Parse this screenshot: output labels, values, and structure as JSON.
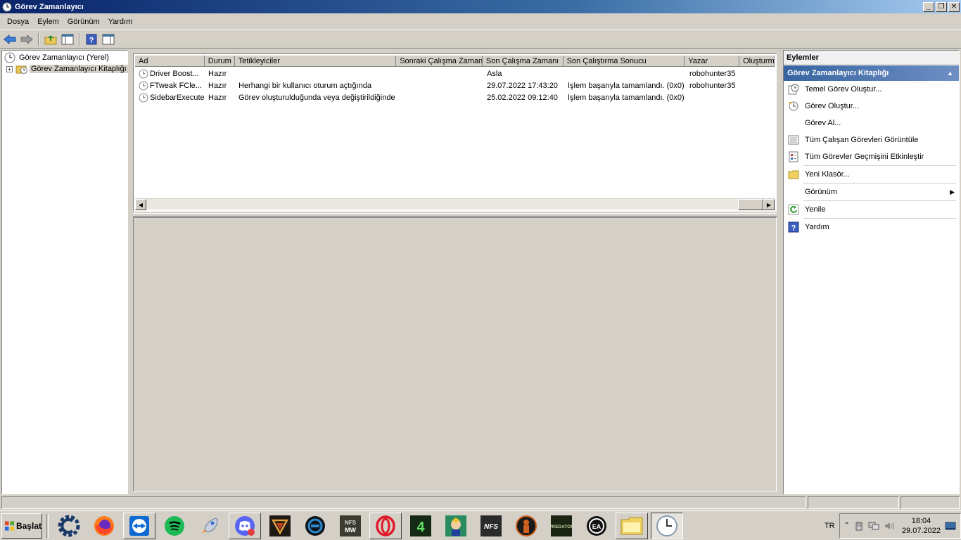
{
  "window": {
    "title": "Görev Zamanlayıcı"
  },
  "menu": [
    "Dosya",
    "Eylem",
    "Görünüm",
    "Yardım"
  ],
  "tree": {
    "root": "Görev Zamanlayıcı (Yerel)",
    "child": "Görev Zamanlayıcı Kitaplığı"
  },
  "tasks": {
    "columns": [
      "Ad",
      "Durum",
      "Tetikleyiciler",
      "Sonraki Çalışma Zamanı",
      "Son Çalışma Zamanı",
      "Son Çalıştırma Sonucu",
      "Yazar",
      "Oluşturm"
    ],
    "rows": [
      {
        "name": "Driver Boost...",
        "status": "Hazır",
        "triggers": "",
        "next_run": "",
        "last_run": "Asla",
        "last_result": "",
        "author": "robohunter35"
      },
      {
        "name": "FTweak FCle...",
        "status": "Hazır",
        "triggers": "Herhangi bir kullanıcı oturum açtığında",
        "next_run": "",
        "last_run": "29.07.2022 17:43:20",
        "last_result": "İşlem başarıyla tamamlandı. (0x0)",
        "author": "robohunter35"
      },
      {
        "name": "SidebarExecute",
        "status": "Hazır",
        "triggers": "Görev oluşturulduğunda veya değiştirildiğinde",
        "next_run": "",
        "last_run": "25.02.2022 09:12:40",
        "last_result": "İşlem başarıyla tamamlandı. (0x0)",
        "author": ""
      }
    ]
  },
  "actions": {
    "title": "Eylemler",
    "section": "Görev Zamanlayıcı Kitaplığı",
    "items": [
      {
        "label": "Temel Görev Oluştur...",
        "icon": "basic-task-icon"
      },
      {
        "label": "Görev Oluştur...",
        "icon": "create-task-icon"
      },
      {
        "label": "Görev Al...",
        "icon": ""
      },
      {
        "label": "Tüm Çalışan Görevleri Görüntüle",
        "icon": "running-tasks-icon"
      },
      {
        "label": "Tüm Görevler Geçmişini Etkinleştir",
        "icon": "history-icon"
      },
      {
        "label": "Yeni Klasör...",
        "icon": "folder-icon"
      },
      {
        "label": "Görünüm",
        "icon": ""
      },
      {
        "label": "Yenile",
        "icon": "refresh-icon"
      },
      {
        "label": "Yardım",
        "icon": "help-icon"
      }
    ]
  },
  "taskbar": {
    "start": "Başlat",
    "language": "TR",
    "time": "18:04",
    "date": "29.07.2022"
  },
  "colors": {
    "titlebar_start": "#0a246a",
    "section_header": "#3764a0",
    "chrome": "#d4d0c8"
  }
}
